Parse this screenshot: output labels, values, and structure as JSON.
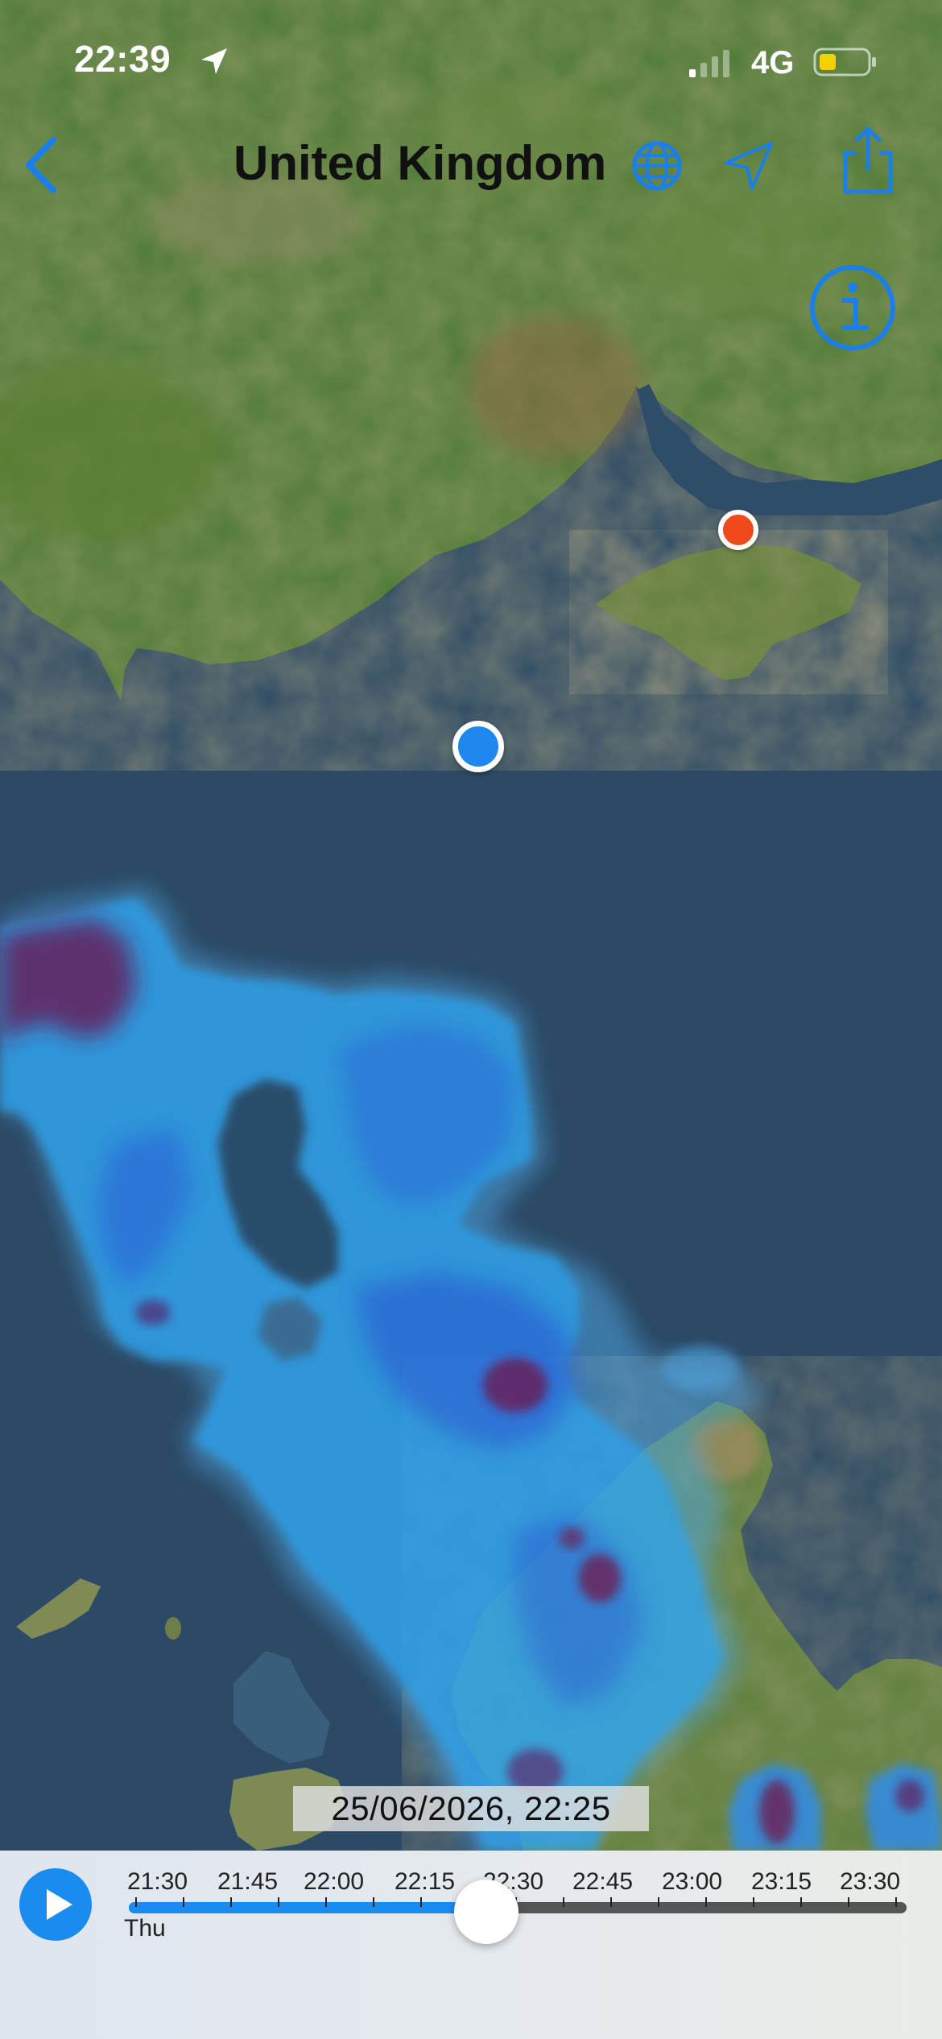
{
  "status_bar": {
    "time": "22:39",
    "network": "4G",
    "location_icon": "location-arrow-icon",
    "signal_icon": "cellular-signal-icon",
    "battery_icon": "battery-low-icon",
    "battery_color": "#f5d000"
  },
  "nav": {
    "back_icon": "chevron-left-icon",
    "title": "United Kingdom",
    "globe_icon": "globe-icon",
    "locate_icon": "location-arrow-outline-icon",
    "share_icon": "share-icon",
    "info_icon": "info-circle-icon",
    "accent_color": "#1a7fe8"
  },
  "map": {
    "user_location_icon": "user-location-dot",
    "pin_icon": "location-pin-dot",
    "pin_color": "#f04a1c"
  },
  "timestamp_label": "25/06/2026, 22:25",
  "timeline": {
    "play_icon": "play-icon",
    "day_label": "Thu",
    "times": [
      "21:30",
      "21:45",
      "22:00",
      "22:15",
      "22:30",
      "22:45",
      "23:00",
      "23:15",
      "23:30"
    ],
    "progress": 0.46,
    "accent_color": "#1a8cf0"
  }
}
